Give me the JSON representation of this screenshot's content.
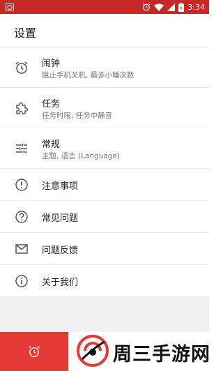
{
  "status_bar": {
    "time": "3:34",
    "icons": [
      "alarm-clock-icon",
      "alarm-icon",
      "wifi-icon",
      "signal-icon",
      "battery-icon"
    ],
    "background": "#c62828"
  },
  "header": {
    "title": "设置"
  },
  "menu": {
    "items": [
      {
        "icon": "alarm-clock-icon",
        "title": "闹钟",
        "subtitle": "阻止手机关机, 最多小睡次数"
      },
      {
        "icon": "puzzle-icon",
        "title": "任务",
        "subtitle": "任务时限, 任务中静音"
      },
      {
        "icon": "sliders-icon",
        "title": "常规",
        "subtitle": "主题, 语言 (Language)"
      },
      {
        "icon": "exclamation-icon",
        "title": "注意事项"
      },
      {
        "icon": "question-icon",
        "title": "常见问题"
      },
      {
        "icon": "mail-icon",
        "title": "问题反馈"
      },
      {
        "icon": "info-icon",
        "title": "关于我们"
      }
    ]
  },
  "bottom_bar": {
    "alarm_tab_icon": "alarm-clock-icon",
    "accent": "#e53935"
  },
  "watermark": {
    "text": "周三手游网",
    "logo": "watermark-logo"
  }
}
